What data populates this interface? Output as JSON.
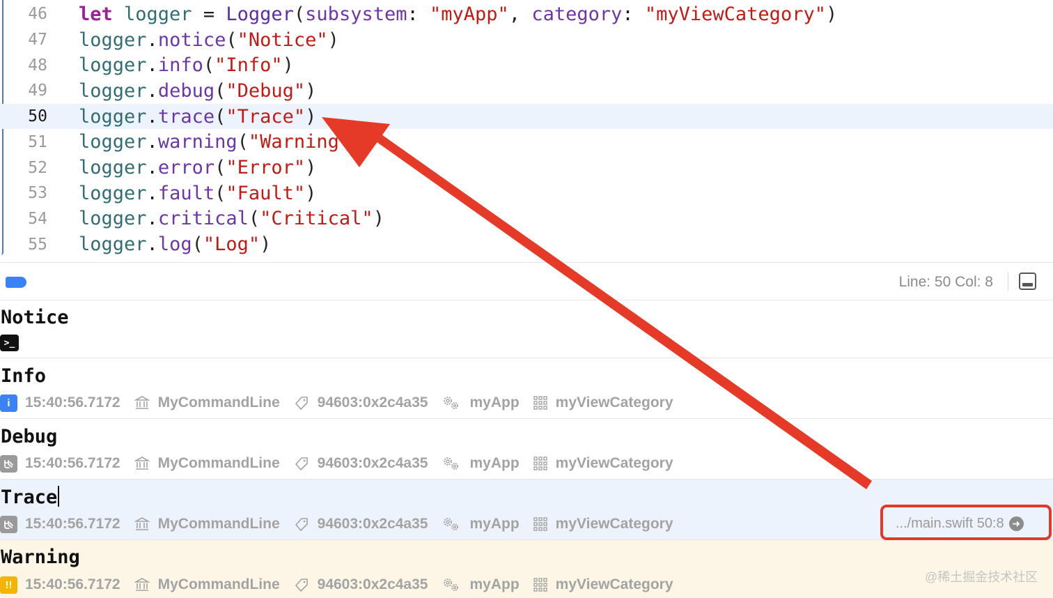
{
  "editor": {
    "lines": [
      {
        "num": "46",
        "tokens": [
          [
            "kw",
            "let "
          ],
          [
            "var",
            "logger"
          ],
          [
            "plain",
            " = "
          ],
          [
            "typ",
            "Logger"
          ],
          [
            "par",
            "("
          ],
          [
            "meth",
            "subsystem"
          ],
          [
            "plain",
            ": "
          ],
          [
            "str",
            "\"myApp\""
          ],
          [
            "plain",
            ", "
          ],
          [
            "meth",
            "category"
          ],
          [
            "plain",
            ": "
          ],
          [
            "str",
            "\"myViewCategory\""
          ],
          [
            "par",
            ")"
          ]
        ]
      },
      {
        "num": "47",
        "tokens": [
          [
            "obj",
            "logger"
          ],
          [
            "plain",
            "."
          ],
          [
            "meth",
            "notice"
          ],
          [
            "par",
            "("
          ],
          [
            "str",
            "\"Notice\""
          ],
          [
            "par",
            ")"
          ]
        ]
      },
      {
        "num": "48",
        "tokens": [
          [
            "obj",
            "logger"
          ],
          [
            "plain",
            "."
          ],
          [
            "meth",
            "info"
          ],
          [
            "par",
            "("
          ],
          [
            "str",
            "\"Info\""
          ],
          [
            "par",
            ")"
          ]
        ]
      },
      {
        "num": "49",
        "tokens": [
          [
            "obj",
            "logger"
          ],
          [
            "plain",
            "."
          ],
          [
            "meth",
            "debug"
          ],
          [
            "par",
            "("
          ],
          [
            "str",
            "\"Debug\""
          ],
          [
            "par",
            ")"
          ]
        ]
      },
      {
        "num": "50",
        "current": true,
        "tokens": [
          [
            "obj",
            "logger"
          ],
          [
            "plain",
            "."
          ],
          [
            "meth",
            "trace"
          ],
          [
            "par",
            "("
          ],
          [
            "str",
            "\"Trace\""
          ],
          [
            "par",
            ")"
          ]
        ]
      },
      {
        "num": "51",
        "tokens": [
          [
            "obj",
            "logger"
          ],
          [
            "plain",
            "."
          ],
          [
            "meth",
            "warning"
          ],
          [
            "par",
            "("
          ],
          [
            "str",
            "\"Warning\""
          ],
          [
            "par",
            ")"
          ]
        ]
      },
      {
        "num": "52",
        "tokens": [
          [
            "obj",
            "logger"
          ],
          [
            "plain",
            "."
          ],
          [
            "meth",
            "error"
          ],
          [
            "par",
            "("
          ],
          [
            "str",
            "\"Error\""
          ],
          [
            "par",
            ")"
          ]
        ]
      },
      {
        "num": "53",
        "tokens": [
          [
            "obj",
            "logger"
          ],
          [
            "plain",
            "."
          ],
          [
            "meth",
            "fault"
          ],
          [
            "par",
            "("
          ],
          [
            "str",
            "\"Fault\""
          ],
          [
            "par",
            ")"
          ]
        ]
      },
      {
        "num": "54",
        "tokens": [
          [
            "obj",
            "logger"
          ],
          [
            "plain",
            "."
          ],
          [
            "meth",
            "critical"
          ],
          [
            "par",
            "("
          ],
          [
            "str",
            "\"Critical\""
          ],
          [
            "par",
            ")"
          ]
        ]
      },
      {
        "num": "55",
        "tokens": [
          [
            "obj",
            "logger"
          ],
          [
            "plain",
            "."
          ],
          [
            "meth",
            "log"
          ],
          [
            "par",
            "("
          ],
          [
            "str",
            "\"Log\""
          ],
          [
            "par",
            ")"
          ]
        ]
      }
    ]
  },
  "console_header": {
    "position_label": "Line: 50  Col: 8"
  },
  "entries": {
    "notice": {
      "message": "Notice",
      "badge": ">_"
    },
    "info": {
      "message": "Info",
      "badge": "i",
      "time": "15:40:56.7172",
      "process": "MyCommandLine",
      "thread": "94603:0x2c4a35",
      "subsystem": "myApp",
      "category": "myViewCategory"
    },
    "debug": {
      "message": "Debug",
      "time": "15:40:56.7172",
      "process": "MyCommandLine",
      "thread": "94603:0x2c4a35",
      "subsystem": "myApp",
      "category": "myViewCategory"
    },
    "trace": {
      "message": "Trace",
      "time": "15:40:56.7172",
      "process": "MyCommandLine",
      "thread": "94603:0x2c4a35",
      "subsystem": "myApp",
      "category": "myViewCategory",
      "source": ".../main.swift 50:8"
    },
    "warning": {
      "message": "Warning",
      "badge": "!!",
      "time": "15:40:56.7172",
      "process": "MyCommandLine",
      "thread": "94603:0x2c4a35",
      "subsystem": "myApp",
      "category": "myViewCategory"
    }
  },
  "watermark": "@稀土掘金技术社区",
  "colors": {
    "accent_blue": "#3b82f6",
    "annotation_red": "#e23a2a",
    "selected_row": "#edf3fc",
    "warning_row": "#fdf6e6"
  },
  "icons": [
    "terminal-icon",
    "info-icon",
    "debug-icon",
    "warning-icon",
    "process-icon",
    "tag-icon",
    "gears-icon",
    "grid-icon",
    "arrow-right-circle-icon",
    "panel-toggle-icon"
  ]
}
